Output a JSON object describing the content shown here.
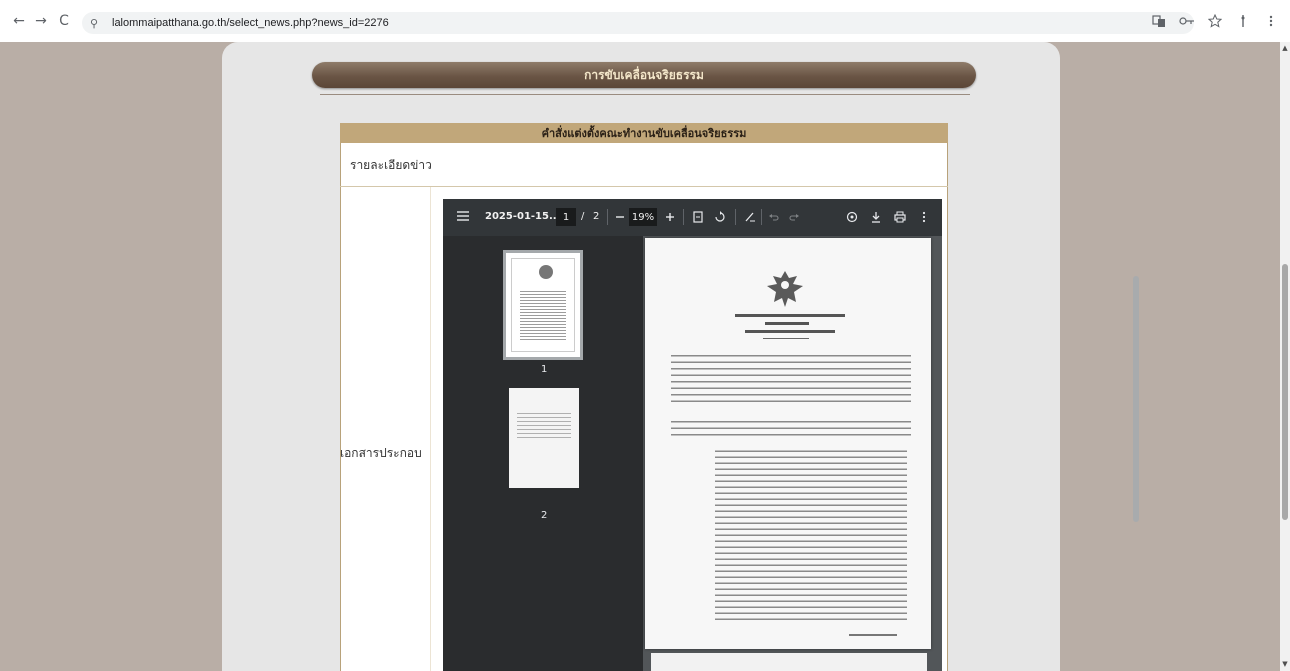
{
  "browser": {
    "url": "lalommaipatthana.go.th/select_news.php?news_id=2276",
    "back_icon": "←",
    "forward_icon": "→",
    "reload_icon": "C",
    "site_info_icon": "⚲"
  },
  "page": {
    "banner_title": "การขับเคลื่อนจริยธรรม",
    "content_header": "คำสั่งแต่งตั้งคณะทำงานขับเคลื่อนจริยธรรม",
    "detail_label": "รายละเอียดข่าว",
    "docs_label": "เอกสารประกอบ"
  },
  "pdf": {
    "filename": "2025-01-15...",
    "current_page": "1",
    "page_separator": "/",
    "total_pages": "2",
    "zoom": "19%",
    "thumbnails": [
      {
        "label": "1"
      },
      {
        "label": "2"
      }
    ]
  }
}
